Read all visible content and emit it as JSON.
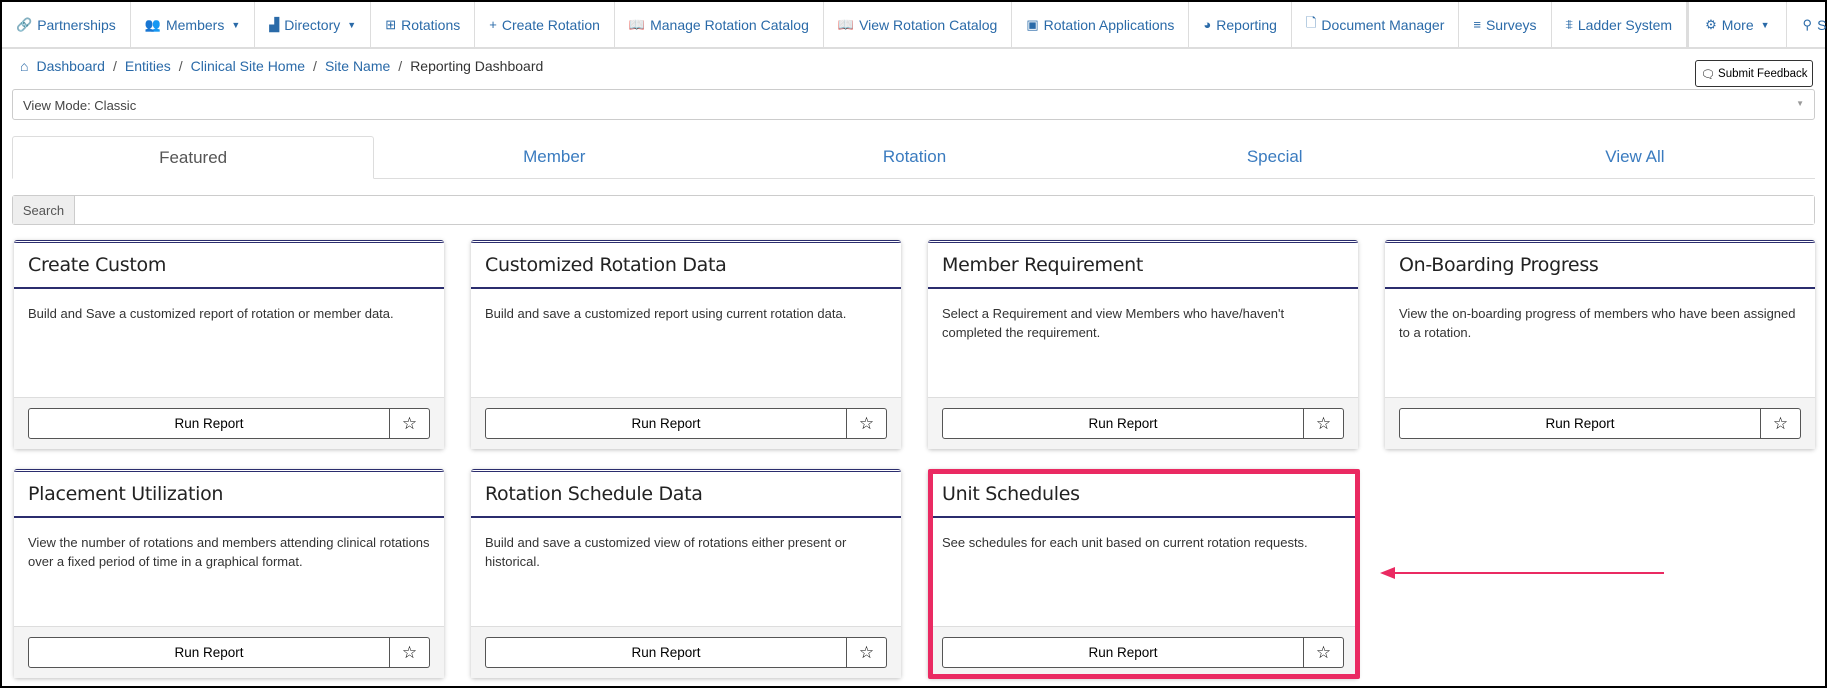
{
  "nav": [
    {
      "icon": "link-icon",
      "glyph": "🔗",
      "label": "Partnerships"
    },
    {
      "icon": "members-icon",
      "glyph": "👥",
      "label": "Members",
      "caret": true
    },
    {
      "icon": "directory-icon",
      "glyph": "▟",
      "label": "Directory",
      "caret": true
    },
    {
      "icon": "grid-icon",
      "glyph": "⊞",
      "label": "Rotations"
    },
    {
      "icon": "plus-icon",
      "glyph": "+",
      "label": "Create Rotation"
    },
    {
      "icon": "book-icon",
      "glyph": "📖",
      "label": "Manage Rotation Catalog"
    },
    {
      "icon": "book-icon",
      "glyph": "📖",
      "label": "View Rotation Catalog"
    },
    {
      "icon": "id-card-icon",
      "glyph": "▣",
      "label": "Rotation Applications"
    },
    {
      "icon": "dashboard-icon",
      "glyph": "◕",
      "label": "Reporting"
    },
    {
      "icon": "file-icon",
      "glyph": "🗋",
      "label": "Document Manager"
    },
    {
      "icon": "list-icon",
      "glyph": "≡",
      "label": "Surveys"
    },
    {
      "icon": "ladder-icon",
      "glyph": "⩨",
      "label": "Ladder System"
    }
  ],
  "nav_right": [
    {
      "icon": "gear-icon",
      "glyph": "⚙",
      "label": "More",
      "caret": true
    },
    {
      "icon": "search-icon",
      "glyph": "⚲",
      "label": "Search",
      "caret": true
    }
  ],
  "breadcrumb": [
    "Dashboard",
    "Entities",
    "Clinical Site Home",
    "Site Name"
  ],
  "breadcrumb_current": "Reporting Dashboard",
  "feedback_label": "Submit Feedback",
  "view_mode": "View Mode: Classic",
  "tabs": [
    "Featured",
    "Member",
    "Rotation",
    "Special",
    "View All"
  ],
  "active_tab": "Featured",
  "search_label": "Search",
  "search_value": "",
  "run_label": "Run Report",
  "cards": [
    {
      "title": "Create Custom",
      "desc": "Build and Save a customized report of rotation or member data."
    },
    {
      "title": "Customized Rotation Data",
      "desc": "Build and save a customized report using current rotation data."
    },
    {
      "title": "Member Requirement",
      "desc": "Select a Requirement and view Members who have/haven't completed the requirement."
    },
    {
      "title": "On-Boarding Progress",
      "desc": "View the on-boarding progress of members who have been assigned to a rotation."
    },
    {
      "title": "Placement Utilization",
      "desc": "View the number of rotations and members attending clinical rotations over a fixed period of time in a graphical format."
    },
    {
      "title": "Rotation Schedule Data",
      "desc": "Build and save a customized view of rotations either present or historical."
    },
    {
      "title": "Unit Schedules",
      "desc": "See schedules for each unit based on current rotation requests."
    }
  ],
  "highlight_color": "#ea2a62"
}
